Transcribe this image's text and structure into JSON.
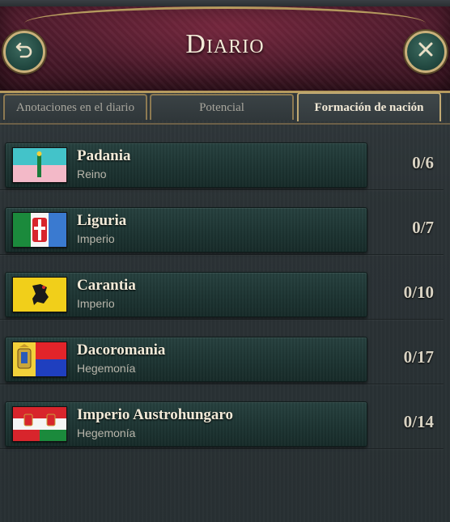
{
  "header": {
    "title": "Diario",
    "back_icon": "back-arrow-icon",
    "close_icon": "close-icon"
  },
  "tabs": [
    {
      "label": "Anotaciones en el diario",
      "active": false
    },
    {
      "label": "Potencial",
      "active": false
    },
    {
      "label": "Formación de nación",
      "active": true
    }
  ],
  "nations": [
    {
      "name": "Padania",
      "type": "Reino",
      "progress": "0/6",
      "flag": "padania-flag"
    },
    {
      "name": "Liguria",
      "type": "Imperio",
      "progress": "0/7",
      "flag": "liguria-flag"
    },
    {
      "name": "Carantia",
      "type": "Imperio",
      "progress": "0/10",
      "flag": "carantia-flag"
    },
    {
      "name": "Dacoromania",
      "type": "Hegemonía",
      "progress": "0/17",
      "flag": "dacoromania-flag"
    },
    {
      "name": "Imperio Austrohungaro",
      "type": "Hegemonía",
      "progress": "0/14",
      "flag": "austrohungaro-flag"
    }
  ],
  "colors": {
    "header_bg": "#4b1a2b",
    "gold_trim": "#b59a5e",
    "card_bg": "#1d3432"
  }
}
